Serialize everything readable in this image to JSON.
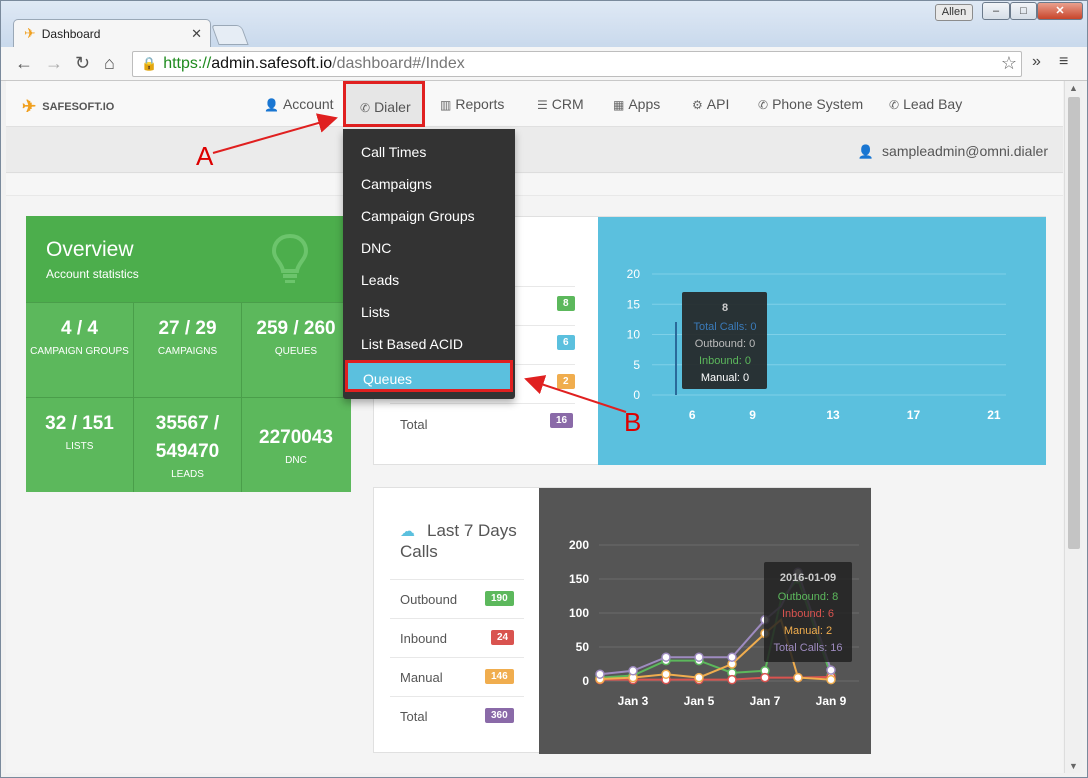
{
  "browser": {
    "tab_title": "Dashboard",
    "user": "Allen",
    "url_scheme": "https://",
    "url_host": "admin.safesoft.io",
    "url_path": "/dashboard#/Index"
  },
  "nav": {
    "brand": "SAFESOFT.IO",
    "items": [
      "Account",
      "Dialer",
      "Reports",
      "CRM",
      "Apps",
      "API",
      "Phone System",
      "Lead Bay"
    ],
    "user_email": "sampleadmin@omni.dialer"
  },
  "dialer_menu": {
    "items": [
      "Call Times",
      "Campaigns",
      "Campaign Groups",
      "DNC",
      "Leads",
      "Lists",
      "List Based ACID",
      "Queues"
    ],
    "highlighted": "Queues"
  },
  "overview": {
    "title": "Overview",
    "subtitle": "Account statistics",
    "stats": [
      {
        "value": "4 / 4",
        "label": "CAMPAIGN GROUPS"
      },
      {
        "value": "27 / 29",
        "label": "CAMPAIGNS"
      },
      {
        "value": "259 / 260",
        "label": "QUEUES"
      },
      {
        "value": "32 / 151",
        "label": "LISTS"
      },
      {
        "value": "35567 / 549470",
        "label": "LEADS"
      },
      {
        "value": "2270043",
        "label": "DNC"
      }
    ]
  },
  "today_calls": {
    "badges": [
      "8",
      "6",
      "2"
    ],
    "badge_colors": [
      "#5cb85c",
      "#5bc0de",
      "#f0ad4e"
    ],
    "total_label": "Total",
    "total_value": "16",
    "total_color": "#8a6aa8",
    "tooltip": {
      "title": "8",
      "total": "Total Calls: 0",
      "outbound": "Outbound: 0",
      "inbound": "Inbound: 0",
      "manual": "Manual: 0"
    }
  },
  "last7": {
    "title": "Last 7 Days Calls",
    "rows": [
      {
        "label": "Outbound",
        "value": "190",
        "color": "#5cb85c"
      },
      {
        "label": "Inbound",
        "value": "24",
        "color": "#d9534f"
      },
      {
        "label": "Manual",
        "value": "146",
        "color": "#f0ad4e"
      },
      {
        "label": "Total",
        "value": "360",
        "color": "#8a6aa8"
      }
    ],
    "tooltip": {
      "title": "2016-01-09",
      "outbound": "Outbound: 8",
      "inbound": "Inbound: 6",
      "manual": "Manual: 2",
      "total": "Total Calls: 16"
    }
  },
  "annotations": {
    "a": "A",
    "b": "B"
  },
  "chart_data": [
    {
      "type": "bar",
      "x": [
        6,
        9,
        13,
        17,
        21
      ],
      "ylim": [
        0,
        20
      ],
      "yticks": [
        0,
        5,
        10,
        15,
        20
      ],
      "xticks": [
        "6",
        "9",
        "13",
        "17",
        "21"
      ],
      "series": []
    },
    {
      "type": "line",
      "xticks": [
        "Jan 3",
        "Jan 5",
        "Jan 7",
        "Jan 9"
      ],
      "yticks": [
        0,
        50,
        100,
        150,
        200
      ],
      "ylim": [
        0,
        200
      ],
      "x": [
        "Jan 2",
        "Jan 3",
        "Jan 4",
        "Jan 5",
        "Jan 6",
        "Jan 7",
        "Jan 7.5",
        "Jan 8",
        "Jan 9"
      ],
      "series": [
        {
          "name": "Outbound",
          "color": "#5cb85c",
          "values": [
            5,
            8,
            30,
            30,
            12,
            15,
            120,
            150,
            8
          ]
        },
        {
          "name": "Inbound",
          "color": "#d9534f",
          "values": [
            2,
            2,
            2,
            2,
            2,
            5,
            5,
            5,
            6
          ]
        },
        {
          "name": "Manual",
          "color": "#f0ad4e",
          "values": [
            3,
            5,
            10,
            5,
            25,
            70,
            90,
            5,
            2
          ]
        },
        {
          "name": "Total Calls",
          "color": "#9e8bc0",
          "values": [
            10,
            15,
            35,
            35,
            35,
            90,
            110,
            160,
            16
          ]
        }
      ]
    }
  ]
}
